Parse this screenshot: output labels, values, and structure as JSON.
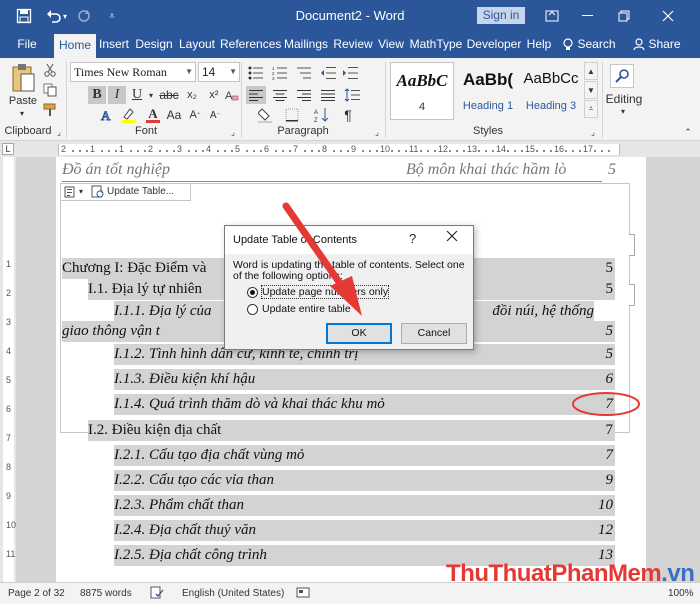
{
  "window": {
    "title": "Document2 - Word",
    "signin_label": "Sign in"
  },
  "quick_access": {
    "save_icon": "save-icon",
    "undo_icon": "undo-icon",
    "redo_icon": "redo-icon",
    "customize_icon": "chevron-down-icon"
  },
  "tabs": [
    {
      "label": "File"
    },
    {
      "label": "Home"
    },
    {
      "label": "Insert"
    },
    {
      "label": "Design"
    },
    {
      "label": "Layout"
    },
    {
      "label": "References"
    },
    {
      "label": "Mailings"
    },
    {
      "label": "Review"
    },
    {
      "label": "View"
    },
    {
      "label": "MathType"
    },
    {
      "label": "Developer"
    },
    {
      "label": "Help"
    },
    {
      "label": "Search"
    },
    {
      "label": "Share"
    }
  ],
  "ribbon": {
    "clipboard": {
      "paste_label": "Paste",
      "group_label": "Clipboard"
    },
    "font": {
      "font_name": "Times New Roman",
      "font_size": "14",
      "group_label": "Font"
    },
    "paragraph": {
      "group_label": "Paragraph"
    },
    "styles": {
      "group_label": "Styles",
      "items": [
        {
          "sample": "AaBbC",
          "name": "4"
        },
        {
          "sample": "AaBb(",
          "name": "Heading 1"
        },
        {
          "sample": "AaBbCc",
          "name": "Heading 3"
        }
      ]
    },
    "editing": {
      "label": "Editing"
    }
  },
  "ruler": {
    "numbers": [
      "2",
      "1",
      "1",
      "2",
      "3",
      "4",
      "5",
      "6",
      "7",
      "8",
      "9",
      "10",
      "11",
      "12",
      "13",
      "14",
      "15",
      "16",
      "17"
    ],
    "vnumbers": [
      "1",
      "2",
      "3",
      "4",
      "5",
      "6",
      "7",
      "8",
      "9",
      "10",
      "11"
    ]
  },
  "document": {
    "header_left": "Đồ án tốt nghiệp",
    "header_right": "Bộ môn khai thác hầm lò",
    "page_number": "5",
    "toc_control_label": "Update Table...",
    "toc": [
      {
        "text": "Chương I: Đặc Điểm và",
        "page": "5"
      },
      {
        "text": "I.1. Địa lý tự  nhiên",
        "page": "5"
      },
      {
        "text": "I.1.1. Địa lý của",
        "continuation": "đồi núi, hệ thống"
      },
      {
        "text": "giao thông vận t",
        "page": "5"
      },
      {
        "text": "I.1.2.  Tình hình dân cư, kinh tế, chính trị",
        "page": "5"
      },
      {
        "text": "I.1.3. Điều kiện khí hậu",
        "page": "6"
      },
      {
        "text": "I.1.4. Quá trình thăm dò và khai thác khu mỏ",
        "page": "7"
      },
      {
        "text": "I.2. Điều kiện địa chất",
        "page": "7"
      },
      {
        "text": "I.2.1. Cấu tạo địa chất vùng mỏ",
        "page": "7"
      },
      {
        "text": "I.2.2. Cấu tạo các vỉa than",
        "page": "9"
      },
      {
        "text": "I.2.3. Phẩm chất than",
        "page": "10"
      },
      {
        "text": "I.2.4. Địa chất thuỷ văn",
        "page": "12"
      },
      {
        "text": "I.2.5. Địa chất công trình",
        "page": "13"
      }
    ]
  },
  "dialog": {
    "title": "Update Table of Contents",
    "help": "?",
    "message": "Word is updating the table of contents.  Select one of the following options:",
    "options": [
      {
        "label": "Update page numbers only",
        "checked": true
      },
      {
        "label": "Update entire table",
        "checked": false
      }
    ],
    "ok_label": "OK",
    "cancel_label": "Cancel"
  },
  "status": {
    "page": "Page 2 of 32",
    "words": "8875 words",
    "language": "English (United States)",
    "zoom": "100%"
  },
  "watermark": {
    "part1": "ThuThuat",
    "part2": "PhanMem",
    "part3": ".vn"
  },
  "colors": {
    "word_blue": "#2b579a",
    "annotation_red": "#e53935",
    "field_shading": "#d3d3d3"
  }
}
